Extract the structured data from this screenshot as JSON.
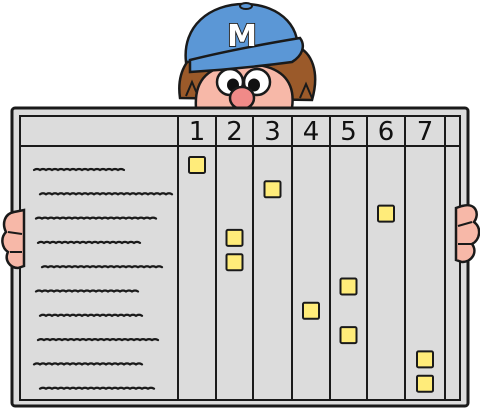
{
  "cap": {
    "letter": "M"
  },
  "board": {
    "columns": [
      {
        "label": "1"
      },
      {
        "label": "2"
      },
      {
        "label": "3"
      },
      {
        "label": "4"
      },
      {
        "label": "5"
      },
      {
        "label": "6"
      },
      {
        "label": "7"
      }
    ],
    "row_count": 10,
    "sticky_notes": [
      {
        "row": 1,
        "col": 1
      },
      {
        "row": 2,
        "col": 3
      },
      {
        "row": 3,
        "col": 6
      },
      {
        "row": 4,
        "col": 2
      },
      {
        "row": 5,
        "col": 2
      },
      {
        "row": 6,
        "col": 5
      },
      {
        "row": 7,
        "col": 4
      },
      {
        "row": 8,
        "col": 5
      },
      {
        "row": 9,
        "col": 7
      },
      {
        "row": 10,
        "col": 7
      }
    ]
  },
  "colors": {
    "board": "#dcdcdc",
    "board_border": "#1a1a1a",
    "cap": "#5b97d6",
    "cap_letter": "#ffffff",
    "sticky_note": "#ffec7a",
    "skin": "#f7b8a8",
    "nose": "#f08a88",
    "hair": "#9b5a2a"
  }
}
